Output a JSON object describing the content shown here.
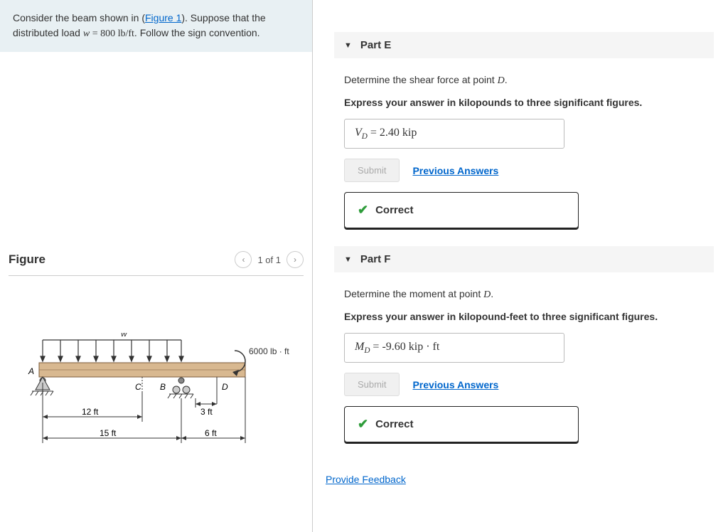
{
  "problem": {
    "text_prefix": "Consider the beam shown in (",
    "figure_link": "Figure 1",
    "text_suffix": "). Suppose that the distributed load ",
    "load_var": "w",
    "load_value": " = 800 lb/ft",
    "text_end": ". Follow the sign convention."
  },
  "figure": {
    "title": "Figure",
    "pager": "1 of 1",
    "load_label": "w",
    "moment_label": "6000 lb · ft",
    "pt_A": "A",
    "pt_B": "B",
    "pt_C": "C",
    "pt_D": "D",
    "dim_12": "12 ft",
    "dim_3": "3 ft",
    "dim_15": "15 ft",
    "dim_6": "6 ft"
  },
  "partE": {
    "title": "Part E",
    "prompt": "Determine the shear force at point D.",
    "instruction": "Express your answer in kilopounds to three significant figures.",
    "var_html": "V",
    "sub": "D",
    "eq": " = ",
    "value": "2.40",
    "unit": " kip",
    "submit": "Submit",
    "prev": "Previous Answers",
    "correct": "Correct"
  },
  "partF": {
    "title": "Part F",
    "prompt": "Determine the moment at point D.",
    "instruction": "Express your answer in kilopound-feet to three significant figures.",
    "var_html": "M",
    "sub": "D",
    "eq": " = ",
    "value": "-9.60",
    "unit": " kip · ft",
    "submit": "Submit",
    "prev": "Previous Answers",
    "correct": "Correct"
  },
  "feedback": "Provide Feedback"
}
